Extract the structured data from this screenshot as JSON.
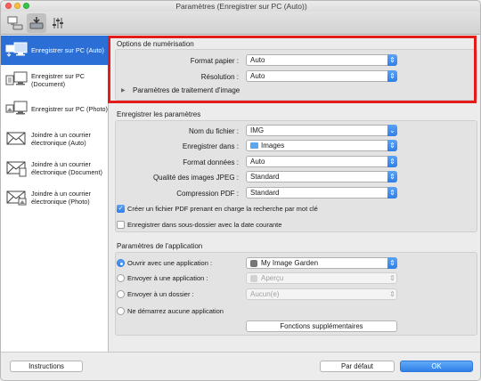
{
  "window": {
    "title": "Paramètres (Enregistrer sur PC (Auto))"
  },
  "toolbar": {
    "tabs": [
      "scan-from-computer-icon",
      "scan-from-operation-panel-icon",
      "general-settings-icon"
    ]
  },
  "sidebar": {
    "items": [
      {
        "label": "Enregistrer sur PC (Auto)",
        "icon": "save-to-pc-icon",
        "selected": true
      },
      {
        "label": "Enregistrer sur PC (Document)",
        "icon": "save-to-pc-document-icon"
      },
      {
        "label": "Enregistrer sur PC (Photo)",
        "icon": "save-to-pc-photo-icon"
      },
      {
        "label": "Joindre à un courrier électronique (Auto)",
        "icon": "attach-email-icon"
      },
      {
        "label": "Joindre à un courrier électronique (Document)",
        "icon": "attach-email-document-icon"
      },
      {
        "label": "Joindre à un courrier électronique (Photo)",
        "icon": "attach-email-photo-icon"
      }
    ]
  },
  "scan_options": {
    "title": "Options de numérisation",
    "paper_size": {
      "label": "Format papier :",
      "value": "Auto"
    },
    "resolution": {
      "label": "Résolution :",
      "value": "Auto"
    },
    "image_processing": "Paramètres de traitement d'image"
  },
  "save_settings": {
    "title": "Enregistrer les paramètres",
    "file_name": {
      "label": "Nom du fichier :",
      "value": "IMG"
    },
    "save_in": {
      "label": "Enregistrer dans :",
      "value": "Images"
    },
    "data_format": {
      "label": "Format données :",
      "value": "Auto"
    },
    "jpeg_quality": {
      "label": "Qualité des images JPEG :",
      "value": "Standard"
    },
    "pdf_compression": {
      "label": "Compression PDF :",
      "value": "Standard"
    },
    "keyword_pdf": {
      "label": "Créer un fichier PDF prenant en charge la recherche par mot clé",
      "checked": true
    },
    "subfolder_date": {
      "label": "Enregistrer dans sous-dossier avec la date courante",
      "checked": false
    }
  },
  "app_settings": {
    "title": "Paramètres de l'application",
    "open_with": {
      "label": "Ouvrir avec une application :",
      "value": "My Image Garden",
      "selected": true
    },
    "send_to_app": {
      "label": "Envoyer à une application :",
      "value": "Aperçu"
    },
    "send_to_folder": {
      "label": "Envoyer à un dossier :",
      "value": "Aucun(e)"
    },
    "no_app": {
      "label": "Ne démarrez aucune application"
    },
    "more_functions": "Fonctions supplémentaires"
  },
  "footer": {
    "instructions": "Instructions",
    "default": "Par défaut",
    "ok": "OK"
  },
  "colors": {
    "accent": "#2b6fd6",
    "highlight_box": "#e21b1b"
  }
}
